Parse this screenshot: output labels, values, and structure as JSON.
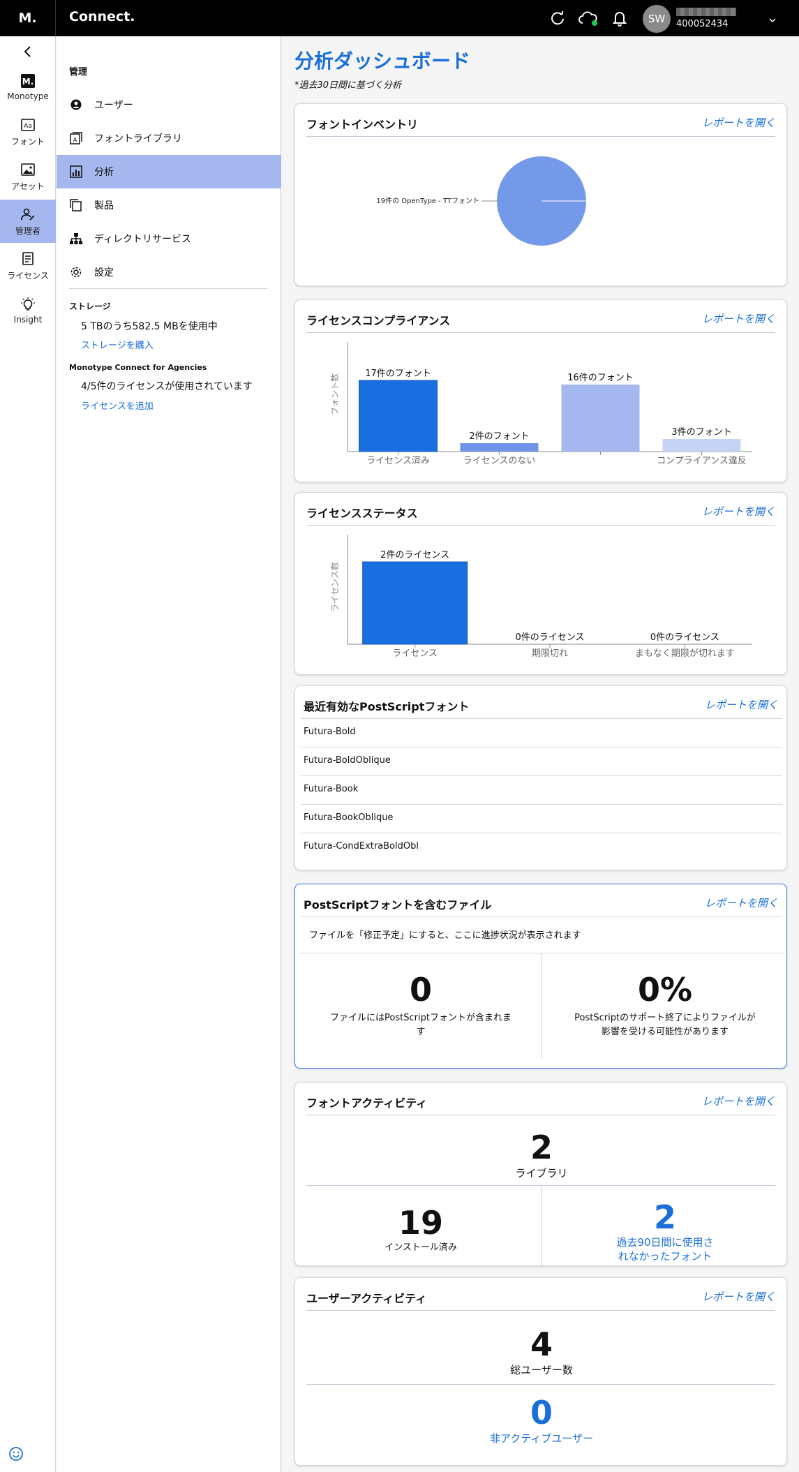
{
  "topbar": {
    "logo": "M.",
    "brand": "Connect.",
    "avatar_initials": "SW",
    "account_id": "400052434"
  },
  "rail": {
    "items": [
      {
        "label": "Monotype",
        "icon": "monotype-logo-icon"
      },
      {
        "label": "フォント",
        "icon": "font-icon"
      },
      {
        "label": "アセット",
        "icon": "image-icon"
      },
      {
        "label": "管理者",
        "icon": "admin-icon"
      },
      {
        "label": "ライセンス",
        "icon": "license-icon"
      },
      {
        "label": "Insight",
        "icon": "lightbulb-icon"
      }
    ]
  },
  "sidebar": {
    "section_title": "管理",
    "items": [
      {
        "label": "ユーザー",
        "icon": "user-icon"
      },
      {
        "label": "フォントライブラリ",
        "icon": "font-library-icon"
      },
      {
        "label": "分析",
        "icon": "analytics-icon"
      },
      {
        "label": "製品",
        "icon": "products-icon"
      },
      {
        "label": "ディレクトリサービス",
        "icon": "directory-icon"
      },
      {
        "label": "設定",
        "icon": "gear-icon"
      }
    ],
    "storage_heading": "ストレージ",
    "storage_text": "5 TBのうち582.5 MBを使用中",
    "storage_link": "ストレージを購入",
    "agencies_heading": "Monotype Connect for Agencies",
    "agencies_text": "4/5件のライセンスが使用されています",
    "agencies_link": "ライセンスを追加"
  },
  "main": {
    "title": "分析ダッシュボード",
    "subtitle": "*過去30日間に基づく分析",
    "report_link": "レポートを開く",
    "font_inventory": {
      "title": "フォントインベントリ"
    },
    "license_compliance": {
      "title": "ライセンスコンプライアンス"
    },
    "license_status": {
      "title": "ライセンスステータス"
    },
    "postscript_recent": {
      "title": "最近有効なPostScriptフォント",
      "fonts": [
        "Futura-Bold",
        "Futura-BoldOblique",
        "Futura-Book",
        "Futura-BookOblique",
        "Futura-CondExtraBoldObl"
      ]
    },
    "postscript_files": {
      "title": "PostScriptフォントを含むファイル",
      "note": "ファイルを「修正予定」にすると、ここに進捗状況が表示されます",
      "count": "0",
      "count_label_1": "ファイルにはPostScriptフォントが含まれま",
      "count_label_2": "す",
      "percent": "0%",
      "percent_label_1": "PostScriptのサポート終了によりファイルが",
      "percent_label_2": "影響を受ける可能性があります"
    },
    "font_activity": {
      "title": "フォントアクティビティ",
      "libraries": "2",
      "libraries_label": "ライブラリ",
      "installed": "19",
      "installed_label": "インストール済み",
      "unused": "2",
      "unused_label_1": "過去90日間に使用さ",
      "unused_label_2": "れなかったフォント"
    },
    "user_activity": {
      "title": "ユーザーアクティビティ",
      "total": "4",
      "total_label": "総ユーザー数",
      "inactive": "0",
      "inactive_label": "非アクティブユーザー"
    }
  },
  "colors": {
    "accent": "#1a6fd9",
    "nav_active": "#a4b8ef",
    "bar_dark": "#1a6fe0",
    "bar_mid": "#6e94ea",
    "bar_light": "#a4b8ef",
    "bar_pale": "#c6d3f5",
    "pie": "#7399e8"
  },
  "chart_data": [
    {
      "type": "pie",
      "labels": [
        "19件の OpenType - TTフォント"
      ],
      "values": [
        19
      ]
    },
    {
      "type": "bar",
      "ylabel": "フォント数",
      "categories": [
        "ライセンス済み",
        "ライセンスのない",
        "",
        "コンプライアンス違反"
      ],
      "values": [
        17,
        2,
        16,
        3
      ],
      "data_labels": [
        "17件のフォント",
        "2件のフォント",
        "16件のフォント",
        "3件のフォント"
      ],
      "colors": [
        "#1a6fe0",
        "#6e94ea",
        "#a4b8ef",
        "#c6d3f5"
      ],
      "ylim": [
        0,
        17
      ]
    },
    {
      "type": "bar",
      "ylabel": "ライセンス数",
      "categories": [
        "ライセンス",
        "期限切れ",
        "まもなく期限が切れます"
      ],
      "values": [
        2,
        0,
        0
      ],
      "data_labels": [
        "2件のライセンス",
        "0件のライセンス",
        "0件のライセンス"
      ],
      "colors": [
        "#1a6fe0",
        "#1a6fe0",
        "#1a6fe0"
      ],
      "ylim": [
        0,
        2
      ]
    }
  ]
}
